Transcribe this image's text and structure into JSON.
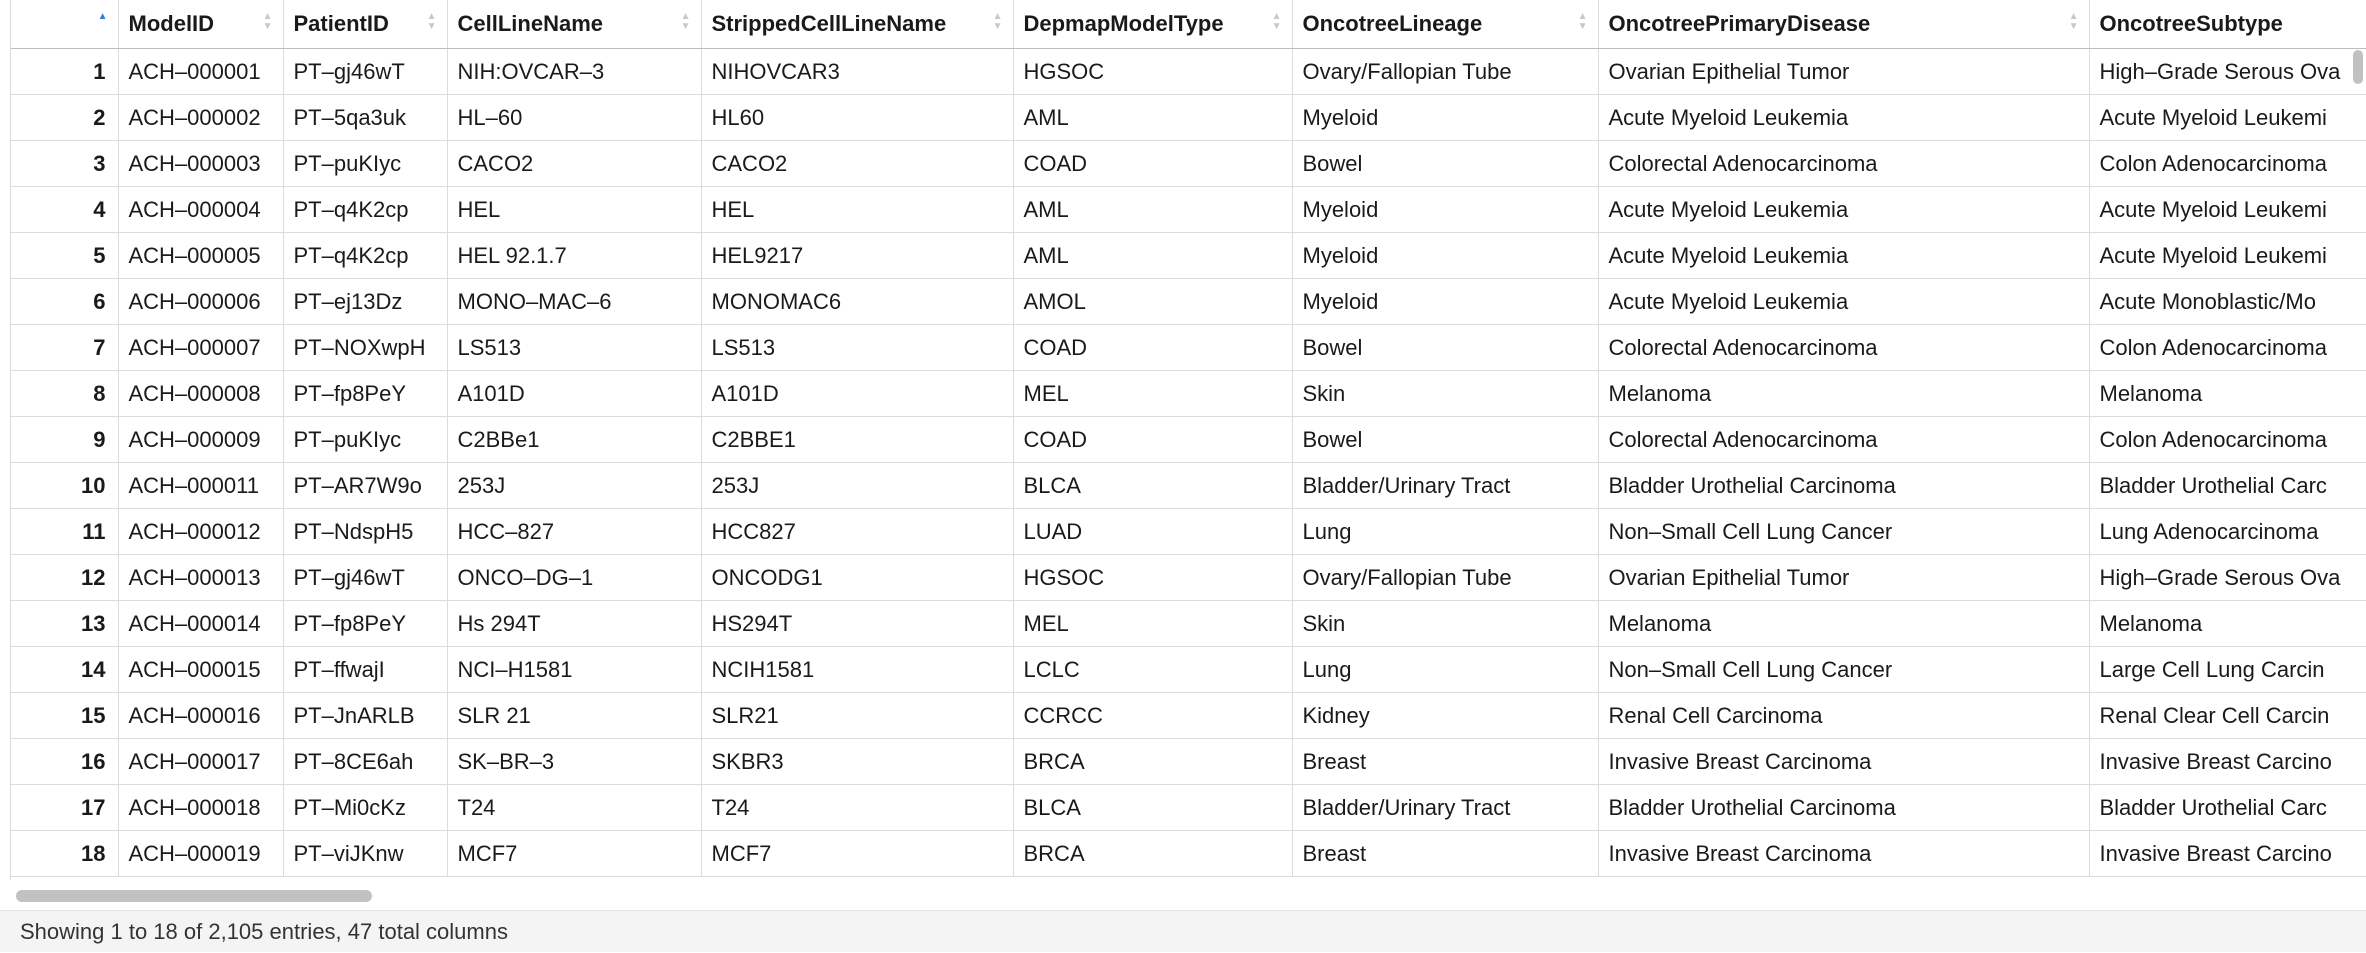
{
  "columns": [
    "",
    "ModelID",
    "PatientID",
    "CellLineName",
    "StrippedCellLineName",
    "DepmapModelType",
    "OncotreeLineage",
    "OncotreePrimaryDisease",
    "OncotreeSubtype"
  ],
  "rows": [
    [
      "1",
      "ACH–000001",
      "PT–gj46wT",
      "NIH:OVCAR–3",
      "NIHOVCAR3",
      "HGSOC",
      "Ovary/Fallopian Tube",
      "Ovarian Epithelial Tumor",
      "High–Grade Serous Ova"
    ],
    [
      "2",
      "ACH–000002",
      "PT–5qa3uk",
      "HL–60",
      "HL60",
      "AML",
      "Myeloid",
      "Acute Myeloid Leukemia",
      "Acute Myeloid Leukemi"
    ],
    [
      "3",
      "ACH–000003",
      "PT–puKIyc",
      "CACO2",
      "CACO2",
      "COAD",
      "Bowel",
      "Colorectal Adenocarcinoma",
      "Colon Adenocarcinoma"
    ],
    [
      "4",
      "ACH–000004",
      "PT–q4K2cp",
      "HEL",
      "HEL",
      "AML",
      "Myeloid",
      "Acute Myeloid Leukemia",
      "Acute Myeloid Leukemi"
    ],
    [
      "5",
      "ACH–000005",
      "PT–q4K2cp",
      "HEL 92.1.7",
      "HEL9217",
      "AML",
      "Myeloid",
      "Acute Myeloid Leukemia",
      "Acute Myeloid Leukemi"
    ],
    [
      "6",
      "ACH–000006",
      "PT–ej13Dz",
      "MONO–MAC–6",
      "MONOMAC6",
      "AMOL",
      "Myeloid",
      "Acute Myeloid Leukemia",
      "Acute Monoblastic/Mo"
    ],
    [
      "7",
      "ACH–000007",
      "PT–NOXwpH",
      "LS513",
      "LS513",
      "COAD",
      "Bowel",
      "Colorectal Adenocarcinoma",
      "Colon Adenocarcinoma"
    ],
    [
      "8",
      "ACH–000008",
      "PT–fp8PeY",
      "A101D",
      "A101D",
      "MEL",
      "Skin",
      "Melanoma",
      "Melanoma"
    ],
    [
      "9",
      "ACH–000009",
      "PT–puKIyc",
      "C2BBe1",
      "C2BBE1",
      "COAD",
      "Bowel",
      "Colorectal Adenocarcinoma",
      "Colon Adenocarcinoma"
    ],
    [
      "10",
      "ACH–000011",
      "PT–AR7W9o",
      "253J",
      "253J",
      "BLCA",
      "Bladder/Urinary Tract",
      "Bladder Urothelial Carcinoma",
      "Bladder Urothelial Carc"
    ],
    [
      "11",
      "ACH–000012",
      "PT–NdspH5",
      "HCC–827",
      "HCC827",
      "LUAD",
      "Lung",
      "Non–Small Cell Lung Cancer",
      "Lung Adenocarcinoma"
    ],
    [
      "12",
      "ACH–000013",
      "PT–gj46wT",
      "ONCO–DG–1",
      "ONCODG1",
      "HGSOC",
      "Ovary/Fallopian Tube",
      "Ovarian Epithelial Tumor",
      "High–Grade Serous Ova"
    ],
    [
      "13",
      "ACH–000014",
      "PT–fp8PeY",
      "Hs 294T",
      "HS294T",
      "MEL",
      "Skin",
      "Melanoma",
      "Melanoma"
    ],
    [
      "14",
      "ACH–000015",
      "PT–ffwajI",
      "NCI–H1581",
      "NCIH1581",
      "LCLC",
      "Lung",
      "Non–Small Cell Lung Cancer",
      "Large Cell Lung Carcin"
    ],
    [
      "15",
      "ACH–000016",
      "PT–JnARLB",
      "SLR 21",
      "SLR21",
      "CCRCC",
      "Kidney",
      "Renal Cell Carcinoma",
      "Renal Clear Cell Carcin"
    ],
    [
      "16",
      "ACH–000017",
      "PT–8CE6ah",
      "SK–BR–3",
      "SKBR3",
      "BRCA",
      "Breast",
      "Invasive Breast Carcinoma",
      "Invasive Breast Carcino"
    ],
    [
      "17",
      "ACH–000018",
      "PT–Mi0cKz",
      "T24",
      "T24",
      "BLCA",
      "Bladder/Urinary Tract",
      "Bladder Urothelial Carcinoma",
      "Bladder Urothelial Carc"
    ],
    [
      "18",
      "ACH–000019",
      "PT–viJKnw",
      "MCF7",
      "MCF7",
      "BRCA",
      "Breast",
      "Invasive Breast Carcinoma",
      "Invasive Breast Carcino"
    ]
  ],
  "footer": {
    "status": "Showing 1 to 18 of 2,105 entries, 47 total columns"
  },
  "colors": {
    "sort_active": "#2f7fd8",
    "grid_line": "#dcdcdc",
    "footer_bg": "#f4f4f4",
    "scroll_thumb": "#c1c1c1"
  },
  "icons": {
    "sort": "sort-arrows-icon",
    "sort_active": "sort-ascending-icon"
  }
}
